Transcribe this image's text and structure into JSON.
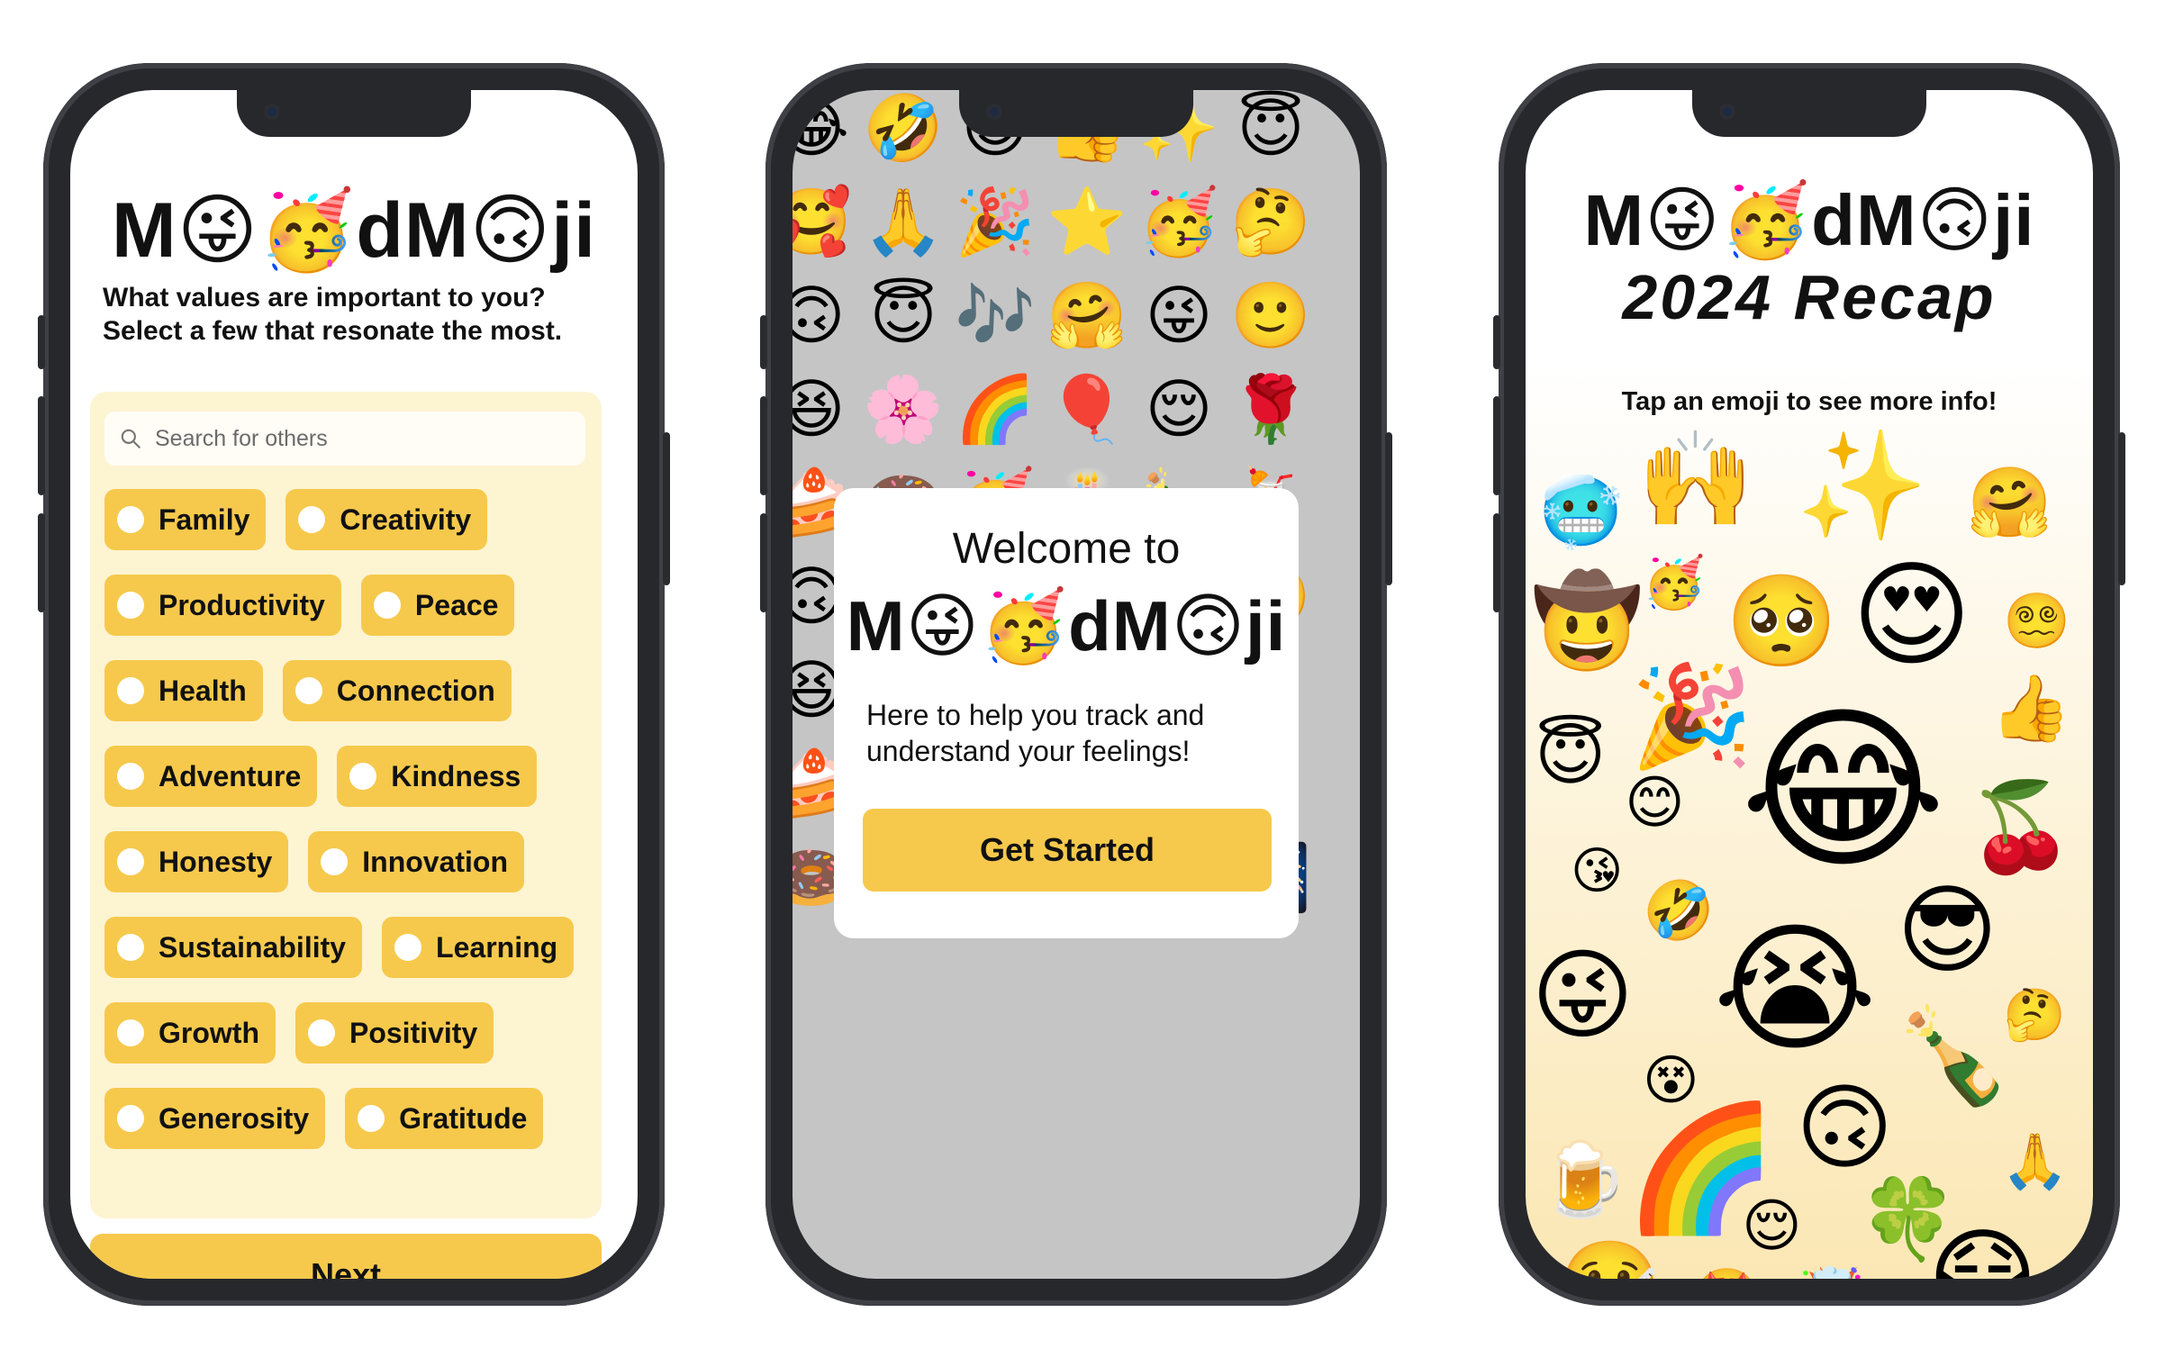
{
  "logo": {
    "m1": "M",
    "e1": "😜",
    "e2": "🥳",
    "dm": "dM",
    "e3": "🙃",
    "ji": "ji"
  },
  "onboarding": {
    "question_line1": "What values are important to you?",
    "question_line2": "Select a few that resonate the most.",
    "search_placeholder": "Search for others",
    "values": [
      "Family",
      "Creativity",
      "Productivity",
      "Peace",
      "Health",
      "Connection",
      "Adventure",
      "Kindness",
      "Honesty",
      "Innovation",
      "Sustainability",
      "Learning",
      "Growth",
      "Positivity",
      "Generosity",
      "Gratitude"
    ],
    "next_label": "Next"
  },
  "welcome": {
    "line1": "Welcome to",
    "tagline_line1": "Here to help you track and",
    "tagline_line2": "understand your feelings!",
    "button_label": "Get Started",
    "background_rows": [
      [
        "😂",
        "🤣",
        "😊",
        "👍",
        "✨",
        "😇"
      ],
      [
        "🥰",
        "🙏",
        "🎉",
        "⭐",
        "🥳",
        "🤔"
      ],
      [
        "🙃",
        "😇",
        "🎶",
        "🤗",
        "😜",
        "🙂"
      ],
      [
        "😆",
        "🌸",
        "🌈",
        "🎈",
        "😌",
        "🌹"
      ],
      [
        "🍰",
        "🍩",
        "🥳",
        "🎂",
        "🍾",
        "🍹"
      ],
      [
        "🙃",
        "😇",
        "🎶",
        "🤗",
        "😜",
        "🙂"
      ],
      [
        "😆",
        "🌸",
        "🌈",
        "🎈",
        "😌",
        "🌹"
      ],
      [
        "🍰",
        "🎁",
        "🎂",
        "🍾",
        "🍻",
        "🍹"
      ],
      [
        "🍩",
        "🍦",
        "🍷",
        "🍭",
        "🎊",
        "🎆"
      ]
    ]
  },
  "recap": {
    "title": "2024 Recap",
    "hint": "Tap an emoji to see more info!",
    "emojis": [
      "🥶",
      "🙌",
      "✨",
      "🤗",
      "🤠",
      "🥳",
      "🥺",
      "😍",
      "😵‍💫",
      "🎉",
      "😂",
      "👍",
      "😇",
      "😊",
      "🍒",
      "😘",
      "🤣",
      "😭",
      "😎",
      "😜",
      "🤔",
      "😵",
      "🍾",
      "🙃",
      "🍺",
      "🌈",
      "😌",
      "🍀",
      "🙏",
      "🤒",
      "🤩",
      "🤯",
      "😷"
    ]
  }
}
